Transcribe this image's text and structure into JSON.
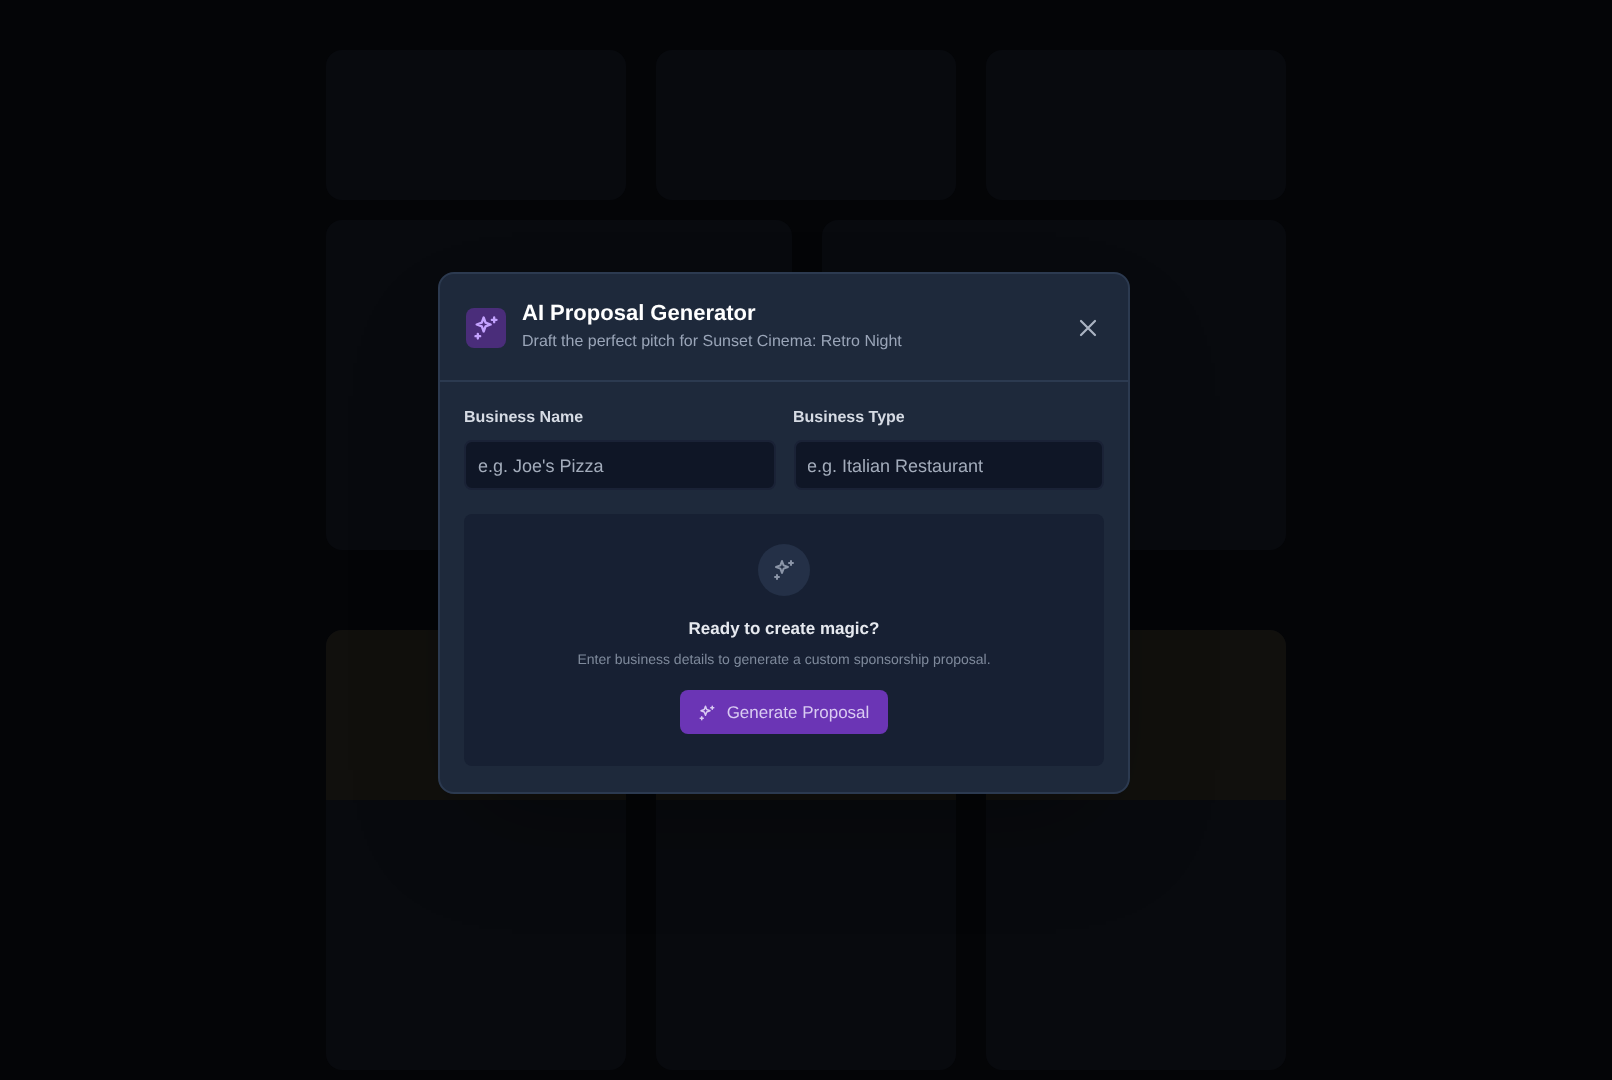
{
  "dialog": {
    "title": "AI Proposal Generator",
    "subtitle": "Draft the perfect pitch for Sunset Cinema: Retro Night",
    "fields": [
      {
        "label": "Business Name",
        "placeholder": "e.g. Joe's Pizza"
      },
      {
        "label": "Business Type",
        "placeholder": "e.g. Italian Restaurant"
      }
    ],
    "empty_state": {
      "heading": "Ready to create magic?",
      "text": "Enter business details to generate a custom sponsorship proposal."
    },
    "button": "Generate Proposal"
  }
}
